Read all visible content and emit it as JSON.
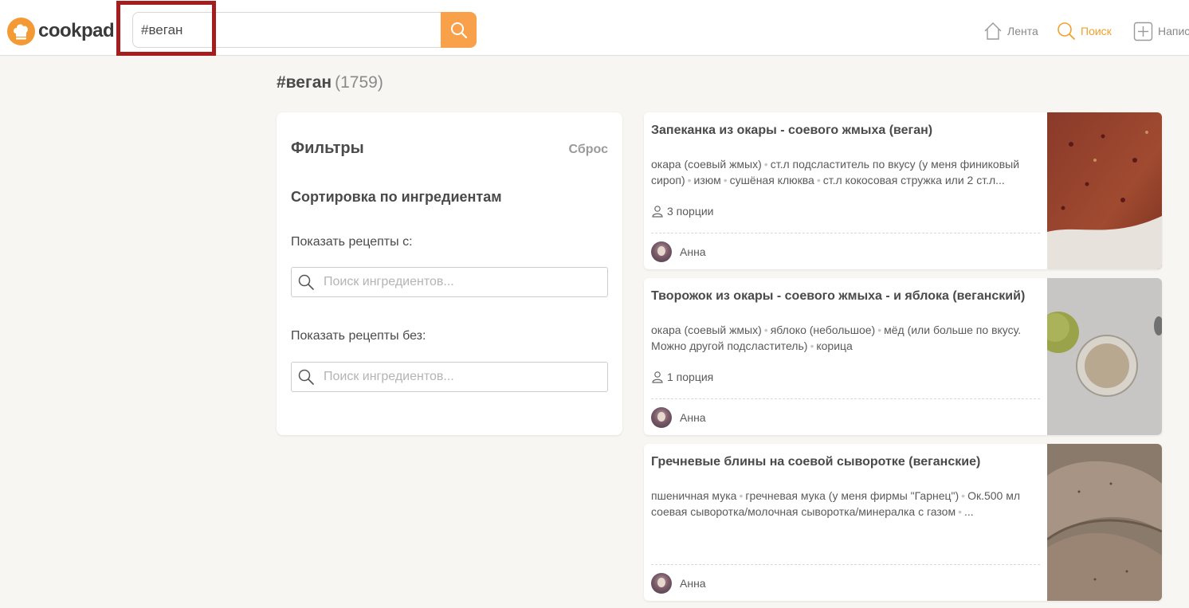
{
  "header": {
    "logo_text": "cookpad",
    "search_value": "#веган",
    "nav": [
      {
        "label": "Лента",
        "icon": "home-icon"
      },
      {
        "label": "Поиск",
        "icon": "search-icon"
      },
      {
        "label": "Напис",
        "icon": "plus-icon"
      }
    ]
  },
  "page": {
    "title": "#веган",
    "count": "(1759)"
  },
  "filters": {
    "title": "Фильтры",
    "reset": "Сброс",
    "sort_title": "Сортировка по ингредиентам",
    "with_label": "Показать рецепты с:",
    "without_label": "Показать рецепты без:",
    "with_placeholder": "Поиск ингредиентов...",
    "without_placeholder": "Поиск ингредиентов..."
  },
  "recipes": [
    {
      "title": "Запеканка из окары - соевого жмыха (веган)",
      "ingredients": [
        "окара (соевый жмых)",
        "ст.л подсластитель по вкусу (у меня финиковый сироп)",
        "изюм",
        "сушёная клюква",
        "ст.л кокосовая стружка или 2 ст.л..."
      ],
      "servings": "3 порции",
      "author": "Анна"
    },
    {
      "title": "Творожок из окары - соевого жмыха - и яблока (веганский)",
      "ingredients": [
        "окара (соевый жмых)",
        "яблоко (небольшое)",
        "мёд (или больше по вкусу. Можно другой подсластитель)",
        "корица"
      ],
      "servings": "1 порция",
      "author": "Анна"
    },
    {
      "title": "Гречневые блины на соевой сыворотке (веганские)",
      "ingredients": [
        "пшеничная мука",
        "гречневая мука (у меня фирмы \"Гарнец\")",
        "Ок.500 мл соевая сыворотка/молочная сыворотка/минералка с газом",
        "..."
      ],
      "servings": "",
      "author": "Анна"
    }
  ],
  "colors": {
    "accent": "#f8a14a",
    "highlight": "#a51d1d",
    "background": "#f8f6f2"
  }
}
